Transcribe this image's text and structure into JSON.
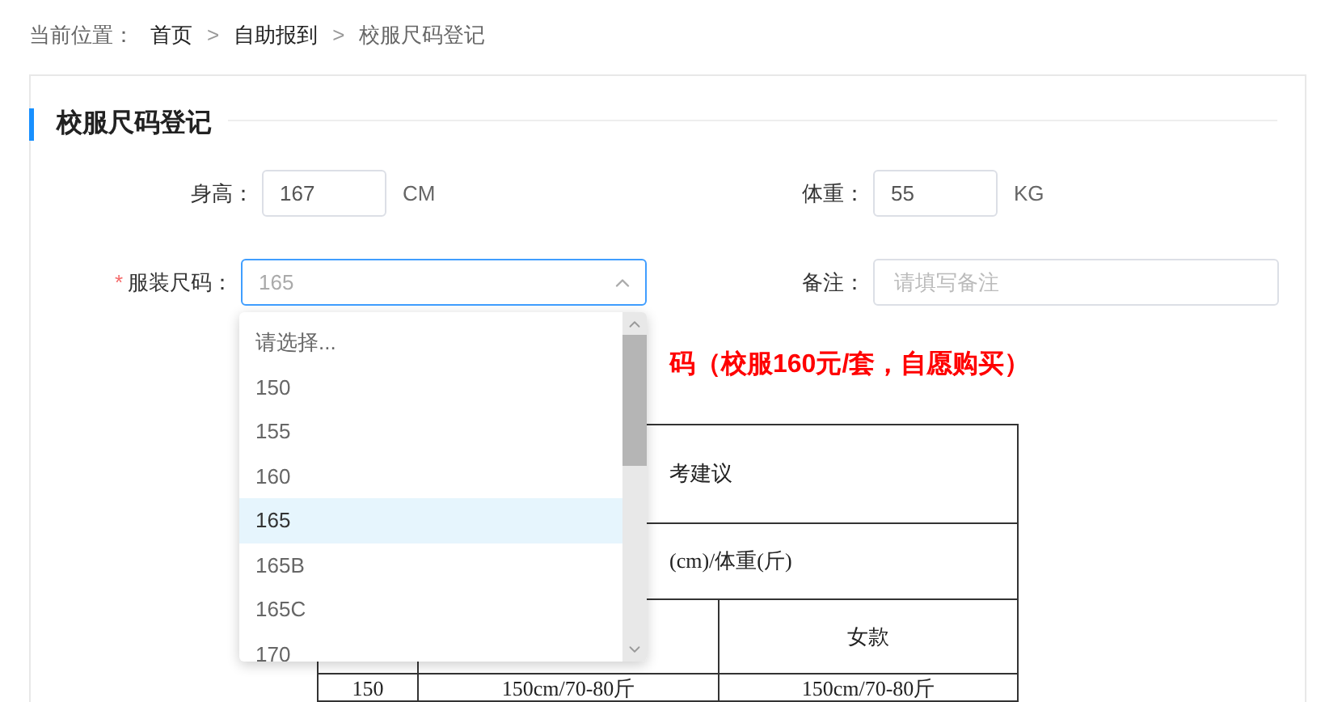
{
  "breadcrumb": {
    "label": "当前位置：",
    "items": [
      {
        "text": "首页",
        "current": false
      },
      {
        "text": "自助报到",
        "separator": ">",
        "current": false
      },
      {
        "text": "校服尺码登记",
        "separator": ">",
        "current": true
      }
    ]
  },
  "section_title": "校服尺码登记",
  "form": {
    "height": {
      "label": "身高：",
      "value": "167",
      "unit": "CM"
    },
    "weight": {
      "label": "体重：",
      "value": "55",
      "unit": "KG"
    },
    "size": {
      "required_mark": "*",
      "label": "服装尺码：",
      "placeholder": "165",
      "open": true,
      "options": [
        {
          "text": "请选择...",
          "selected": false
        },
        {
          "text": "150",
          "selected": false
        },
        {
          "text": "155",
          "selected": false
        },
        {
          "text": "160",
          "selected": false
        },
        {
          "text": "165",
          "selected": true
        },
        {
          "text": "165B",
          "selected": false
        },
        {
          "text": "165C",
          "selected": false
        },
        {
          "text": "170",
          "selected": false
        }
      ]
    },
    "remark": {
      "label": "备注：",
      "placeholder": "请填写备注"
    }
  },
  "notice": "码（校服160元/套，自愿购买）",
  "table": {
    "row_1": "考建议",
    "row_2": "(cm)/体重(斤)",
    "row_3_column_3": "女款",
    "rows": [
      [
        "150",
        "150cm/70-80斤",
        "150cm/70-80斤"
      ]
    ]
  }
}
